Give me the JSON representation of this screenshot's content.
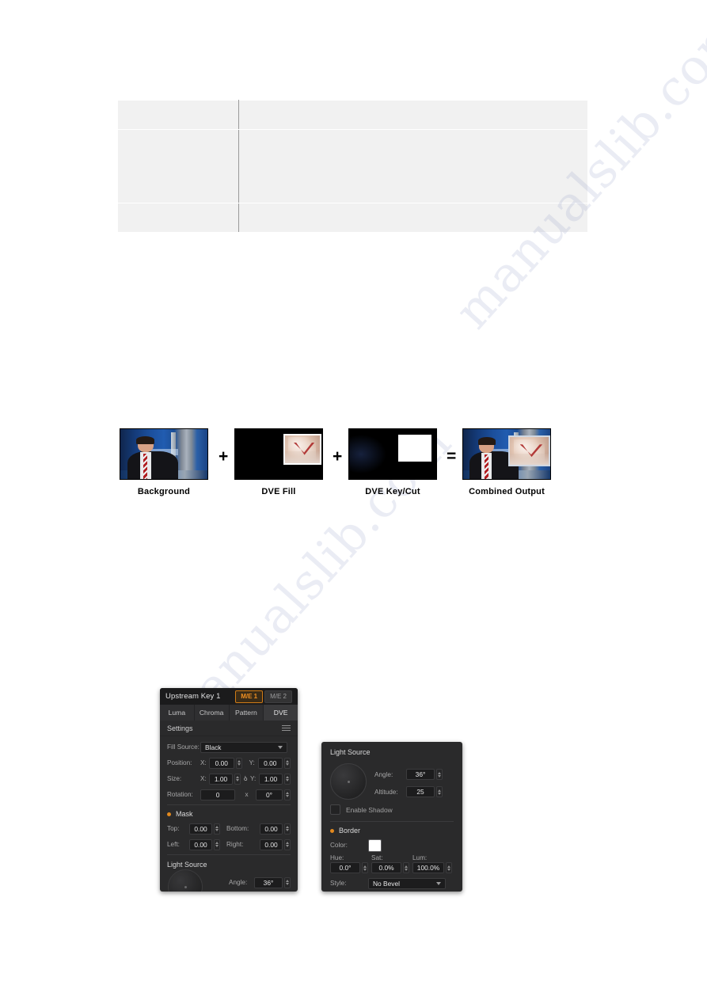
{
  "watermark": {
    "line1": "manualslib.com",
    "line2": "manualslib.com"
  },
  "doc_table": {
    "rows": [
      {
        "left": "",
        "right": ""
      },
      {
        "left": "",
        "right": ""
      },
      {
        "left": "",
        "right": ""
      }
    ]
  },
  "diagram": {
    "items": [
      {
        "label": "Background",
        "kind": "studio"
      },
      {
        "label": "DVE Fill",
        "kind": "dve-fill"
      },
      {
        "label": "DVE Key/Cut",
        "kind": "dve-key"
      },
      {
        "label": "Combined Output",
        "kind": "combined"
      }
    ],
    "operators": [
      "+",
      "+",
      "="
    ]
  },
  "left_panel": {
    "title": "Upstream Key 1",
    "me_tabs": [
      {
        "label": "M/E 1",
        "active": true
      },
      {
        "label": "M/E 2",
        "active": false
      }
    ],
    "key_tabs": [
      {
        "label": "Luma",
        "active": false
      },
      {
        "label": "Chroma",
        "active": false
      },
      {
        "label": "Pattern",
        "active": false
      },
      {
        "label": "DVE",
        "active": true
      }
    ],
    "settings": {
      "header": "Settings",
      "menu_icon": "hamburger-icon",
      "fill_source_label": "Fill Source:",
      "fill_source_value": "Black",
      "position_label": "Position:",
      "position_x_label": "X:",
      "position_x_value": "0.00",
      "position_y_label": "Y:",
      "position_y_value": "0.00",
      "size_label": "Size:",
      "size_x_label": "X:",
      "size_x_value": "1.00",
      "size_link_icon": "link-icon",
      "size_y_label": "Y:",
      "size_y_value": "1.00",
      "rotation_label": "Rotation:",
      "rotation_value": "0",
      "rotation_unit": "x",
      "rotation_degrees": "0°"
    },
    "mask": {
      "header": "Mask",
      "top_label": "Top:",
      "top_value": "0.00",
      "bottom_label": "Bottom:",
      "bottom_value": "0.00",
      "left_label": "Left:",
      "left_value": "0.00",
      "right_label": "Right:",
      "right_value": "0.00"
    },
    "light_source": {
      "header": "Light Source",
      "angle_label": "Angle:",
      "angle_value": "36°"
    }
  },
  "right_panel": {
    "light_source": {
      "header": "Light Source",
      "knob_icon": "rotary-knob-icon",
      "angle_label": "Angle:",
      "angle_value": "36°",
      "altitude_label": "Altitude:",
      "altitude_value": "25",
      "enable_shadow_label": "Enable Shadow",
      "enable_shadow_checked": false
    },
    "border": {
      "header": "Border",
      "color_label": "Color:",
      "color_value": "#ffffff",
      "hue_label": "Hue:",
      "hue_value": "0.0°",
      "sat_label": "Sat:",
      "sat_value": "0.0%",
      "lum_label": "Lum:",
      "lum_value": "100.0%",
      "style_label": "Style:",
      "style_value": "No Bevel"
    }
  },
  "colors": {
    "accent_orange": "#f19021",
    "panel_bg": "#2a2a2b",
    "field_bg": "#1c1c1d"
  }
}
